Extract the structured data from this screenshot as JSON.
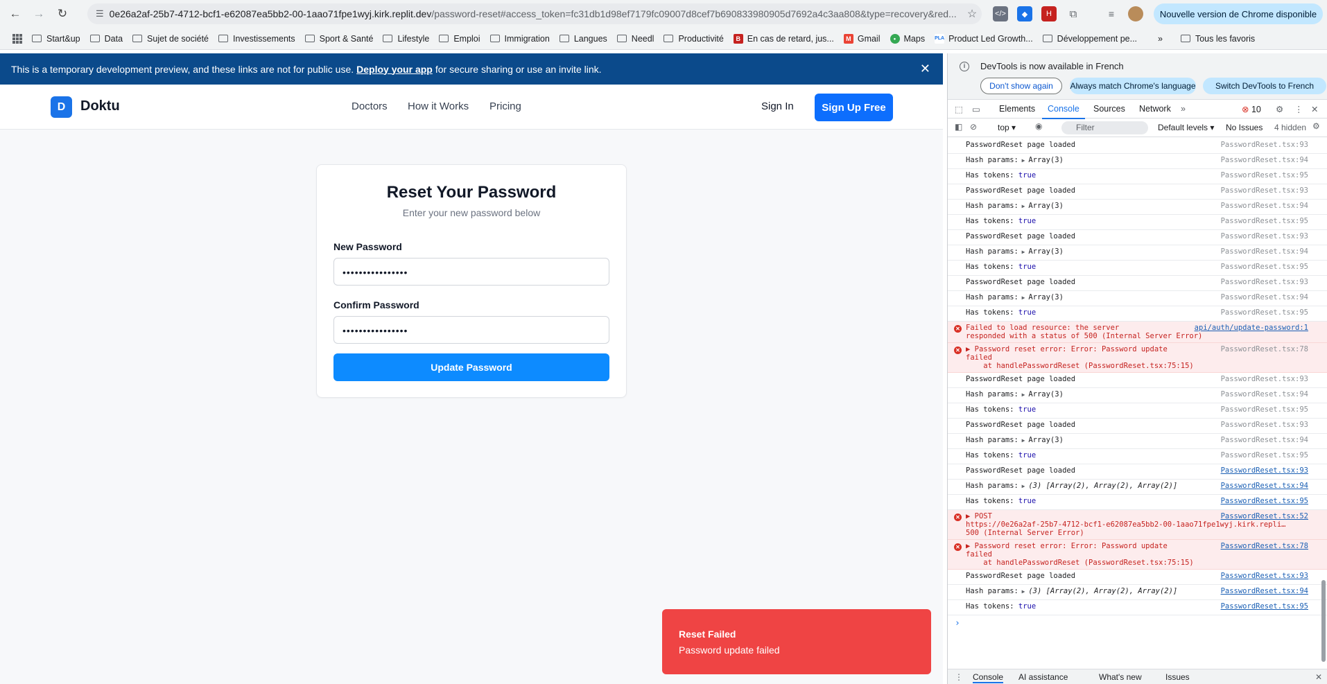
{
  "browser": {
    "url_host": "0e26a2af-25b7-4712-bcf1-e62087ea5bb2-00-1aao71fpe1wyj.kirk.replit.dev",
    "url_rest": "/password-reset#access_token=fc31db1d98ef7179fc09007d8cef7b690833980905d7692a4c3aa808&type=recovery&red...",
    "update_label": "Nouvelle version de Chrome disponible",
    "bookmarks": [
      "Start&up",
      "Data",
      "Sujet de société",
      "Investissements",
      "Sport & Santé",
      "Lifestyle",
      "Emploi",
      "Immigration",
      "Langues",
      "Needl",
      "Productivité",
      "En cas de retard, jus...",
      "Gmail",
      "Maps",
      "Product Led Growth...",
      "Développement pe...",
      "Tous les favoris"
    ]
  },
  "banner": {
    "text_before": "This is a temporary development preview, and these links are not for public use.",
    "link": "Deploy your app",
    "text_after": "for secure sharing or use an invite link."
  },
  "app": {
    "logo_letter": "D",
    "logo_name": "Doktu",
    "nav": [
      "Doctors",
      "How it Works",
      "Pricing"
    ],
    "sign_in": "Sign In",
    "sign_up": "Sign Up Free"
  },
  "form": {
    "title": "Reset Your Password",
    "subtitle": "Enter your new password below",
    "new_label": "New Password",
    "new_value": "••••••••••••••••",
    "confirm_label": "Confirm Password",
    "confirm_value": "••••••••••••••••",
    "button": "Update Password"
  },
  "toast": {
    "title": "Reset Failed",
    "description": "Password update failed"
  },
  "devtools": {
    "info": "DevTools is now available in French",
    "dont_show": "Don't show again",
    "match_lang": "Always match Chrome's language",
    "switch": "Switch DevTools to French",
    "tabs": [
      "Elements",
      "Console",
      "Sources",
      "Network"
    ],
    "error_count": "10",
    "context": "top",
    "filter": "Filter",
    "levels": "Default levels",
    "issues": "No Issues",
    "hidden": "4 hidden",
    "bottom_tabs": [
      "Console",
      "AI assistance",
      "What's new",
      "Issues"
    ],
    "log": [
      {
        "type": "log",
        "text": "PasswordReset page loaded",
        "src": "PasswordReset.tsx:93"
      },
      {
        "type": "arr",
        "text": "Hash params:",
        "val": "Array(3)",
        "src": "PasswordReset.tsx:94"
      },
      {
        "type": "tok",
        "text": "Has tokens:",
        "val": "true",
        "src": "PasswordReset.tsx:95"
      },
      {
        "type": "log",
        "text": "PasswordReset page loaded",
        "src": "PasswordReset.tsx:93"
      },
      {
        "type": "arr",
        "text": "Hash params:",
        "val": "Array(3)",
        "src": "PasswordReset.tsx:94"
      },
      {
        "type": "tok",
        "text": "Has tokens:",
        "val": "true",
        "src": "PasswordReset.tsx:95"
      },
      {
        "type": "log",
        "text": "PasswordReset page loaded",
        "src": "PasswordReset.tsx:93"
      },
      {
        "type": "arr",
        "text": "Hash params:",
        "val": "Array(3)",
        "src": "PasswordReset.tsx:94"
      },
      {
        "type": "tok",
        "text": "Has tokens:",
        "val": "true",
        "src": "PasswordReset.tsx:95"
      },
      {
        "type": "log",
        "text": "PasswordReset page loaded",
        "src": "PasswordReset.tsx:93"
      },
      {
        "type": "arr",
        "text": "Hash params:",
        "val": "Array(3)",
        "src": "PasswordReset.tsx:94"
      },
      {
        "type": "tok",
        "text": "Has tokens:",
        "val": "true",
        "src": "PasswordReset.tsx:95"
      },
      {
        "type": "err",
        "lines": [
          "Failed to load resource: the server",
          "responded with a status of 500 (Internal Server Error)"
        ],
        "src": "api/auth/update-password:1",
        "link": true
      },
      {
        "type": "err",
        "lines": [
          "▶ Password reset error: Error: Password update",
          "failed",
          "    at handlePasswordReset (PasswordReset.tsx:75:15)"
        ],
        "src": "PasswordReset.tsx:78",
        "link": false
      },
      {
        "type": "log",
        "text": "PasswordReset page loaded",
        "src": "PasswordReset.tsx:93"
      },
      {
        "type": "arr",
        "text": "Hash params:",
        "val": "Array(3)",
        "src": "PasswordReset.tsx:94"
      },
      {
        "type": "tok",
        "text": "Has tokens:",
        "val": "true",
        "src": "PasswordReset.tsx:95"
      },
      {
        "type": "log",
        "text": "PasswordReset page loaded",
        "src": "PasswordReset.tsx:93"
      },
      {
        "type": "arr",
        "text": "Hash params:",
        "val": "Array(3)",
        "src": "PasswordReset.tsx:94"
      },
      {
        "type": "tok",
        "text": "Has tokens:",
        "val": "true",
        "src": "PasswordReset.tsx:95"
      },
      {
        "type": "log",
        "text": "PasswordReset page loaded",
        "src": "PasswordReset.tsx:93",
        "link": true
      },
      {
        "type": "arr",
        "text": "Hash params:",
        "val": "(3) [Array(2), Array(2), Array(2)]",
        "src": "PasswordReset.tsx:94",
        "link": true
      },
      {
        "type": "tok",
        "text": "Has tokens:",
        "val": "true",
        "src": "PasswordReset.tsx:95",
        "link": true
      },
      {
        "type": "err",
        "lines": [
          "▶ POST",
          "https://0e26a2af-25b7-4712-bcf1-e62087ea5bb2-00-1aao71fpe1wyj.kirk.repli…",
          "500 (Internal Server Error)"
        ],
        "src": "PasswordReset.tsx:52",
        "link": true
      },
      {
        "type": "err",
        "lines": [
          "▶ Password reset error: Error: Password update",
          "failed",
          "    at handlePasswordReset (PasswordReset.tsx:75:15)"
        ],
        "src": "PasswordReset.tsx:78",
        "link": true
      },
      {
        "type": "log",
        "text": "PasswordReset page loaded",
        "src": "PasswordReset.tsx:93",
        "link": true
      },
      {
        "type": "arr",
        "text": "Hash params:",
        "val": "(3) [Array(2), Array(2), Array(2)]",
        "src": "PasswordReset.tsx:94",
        "link": true
      },
      {
        "type": "tok",
        "text": "Has tokens:",
        "val": "true",
        "src": "PasswordReset.tsx:95",
        "link": true
      }
    ]
  }
}
